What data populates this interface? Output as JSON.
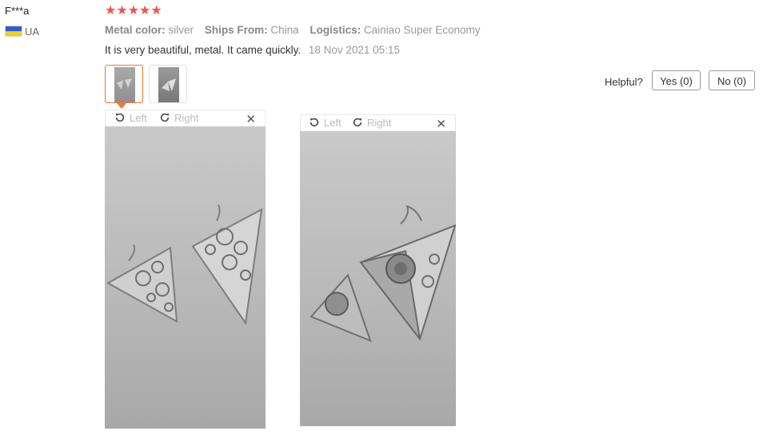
{
  "reviewer": {
    "name": "F***a",
    "country": "UA"
  },
  "rating": {
    "stars": "★★★★★"
  },
  "attributes": [
    {
      "key": "Metal color:",
      "value": "silver"
    },
    {
      "key": "Ships From:",
      "value": "China"
    },
    {
      "key": "Logistics:",
      "value": "Cainiao Super Economy"
    }
  ],
  "review": {
    "text": "It is very beautiful, metal. It came quickly.",
    "date": "18 Nov 2021 05:15"
  },
  "helpful": {
    "label": "Helpful?",
    "yes": "Yes (0)",
    "no": "No (0)"
  },
  "viewer": {
    "left_label": "Left",
    "right_label": "Right",
    "close": "✕"
  },
  "colors": {
    "stars": "#f0554a",
    "active_border": "#f4772a",
    "flag_blue": "#2b5bd6",
    "flag_yellow": "#f4d100"
  }
}
